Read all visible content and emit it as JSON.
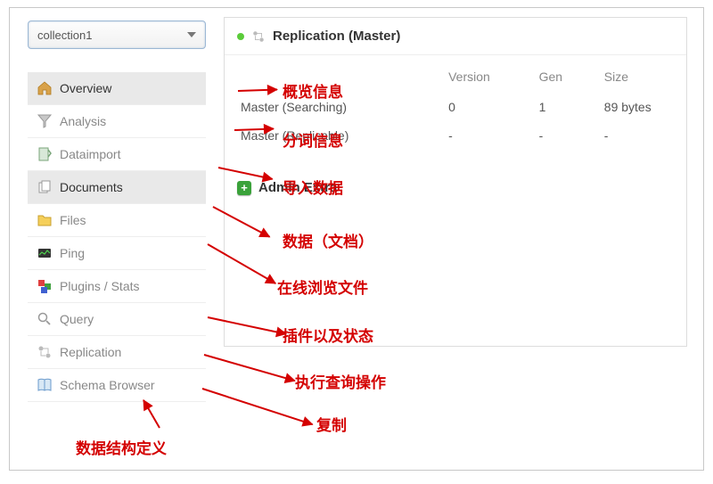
{
  "dropdown": {
    "value": "collection1"
  },
  "sidebar": {
    "items": [
      {
        "label": "Overview",
        "icon": "home"
      },
      {
        "label": "Analysis",
        "icon": "funnel"
      },
      {
        "label": "Dataimport",
        "icon": "import"
      },
      {
        "label": "Documents",
        "icon": "docs"
      },
      {
        "label": "Files",
        "icon": "folder"
      },
      {
        "label": "Ping",
        "icon": "ping"
      },
      {
        "label": "Plugins / Stats",
        "icon": "plugins"
      },
      {
        "label": "Query",
        "icon": "search"
      },
      {
        "label": "Replication",
        "icon": "replication"
      },
      {
        "label": "Schema Browser",
        "icon": "book"
      }
    ]
  },
  "panel": {
    "title": "Replication (Master)",
    "table": {
      "headers": [
        "",
        "Version",
        "Gen",
        "Size"
      ],
      "rows": [
        {
          "name": "Master (Searching)",
          "version": "0",
          "gen": "1",
          "size": "89 bytes"
        },
        {
          "name": "Master (Replicable)",
          "version": "-",
          "gen": "-",
          "size": "-"
        }
      ]
    },
    "extra": {
      "label": "Admin Extra"
    }
  },
  "annotations": {
    "overview": "概览信息",
    "analysis": "分词信息",
    "dataimport": "导入数据",
    "documents": "数据（文档）",
    "files": "在线浏览文件",
    "plugins": "插件以及状态",
    "query": "执行查询操作",
    "replication": "复制",
    "schema": "数据结构定义"
  }
}
